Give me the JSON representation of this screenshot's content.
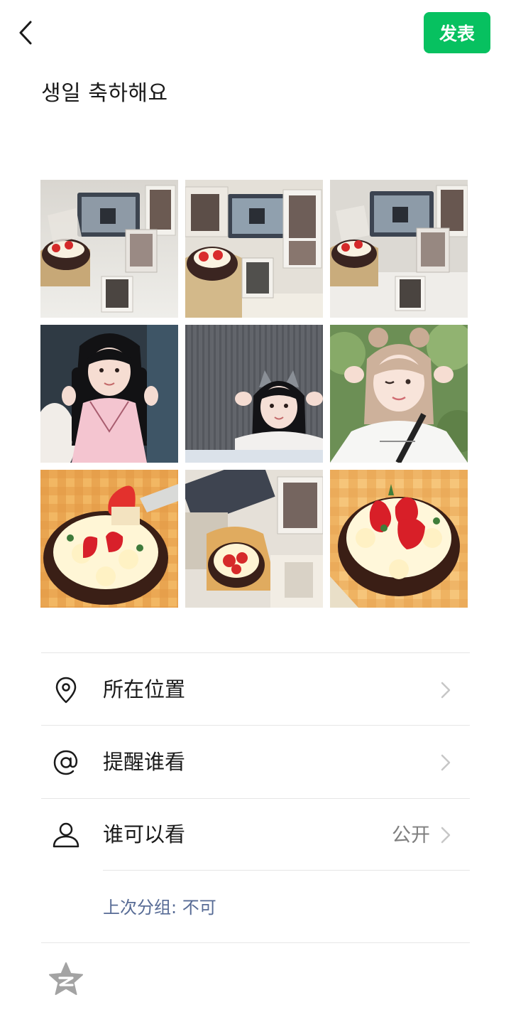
{
  "header": {
    "back_icon": "chevron-left-icon",
    "publish_label": "发表",
    "publish_color": "#07c160"
  },
  "post": {
    "text": "생일 축하해요"
  },
  "photos": [
    {
      "subject": "cake-and-photo-cards-desk"
    },
    {
      "subject": "cake-and-photo-cards-desk"
    },
    {
      "subject": "cake-and-photo-cards-desk"
    },
    {
      "subject": "girl-with-twin-tails"
    },
    {
      "subject": "girl-with-cat-ears-headband"
    },
    {
      "subject": "girl-with-hair-buns-winking"
    },
    {
      "subject": "strawberry-chocolate-cake"
    },
    {
      "subject": "strawberry-cake-on-desk"
    },
    {
      "subject": "strawberry-chocolate-cake"
    }
  ],
  "options": {
    "location": {
      "icon": "location-pin-icon",
      "label": "所在位置"
    },
    "mention": {
      "icon": "at-icon",
      "label": "提醒谁看"
    },
    "visibility": {
      "icon": "person-icon",
      "label": "谁可以看",
      "value": "公开"
    },
    "last_group": "上次分组: 不可",
    "qzone_icon": "qzone-star-icon"
  },
  "colors": {
    "link": "#576b95",
    "value_text": "#7f7f7f",
    "divider": "#e6e6e6"
  }
}
